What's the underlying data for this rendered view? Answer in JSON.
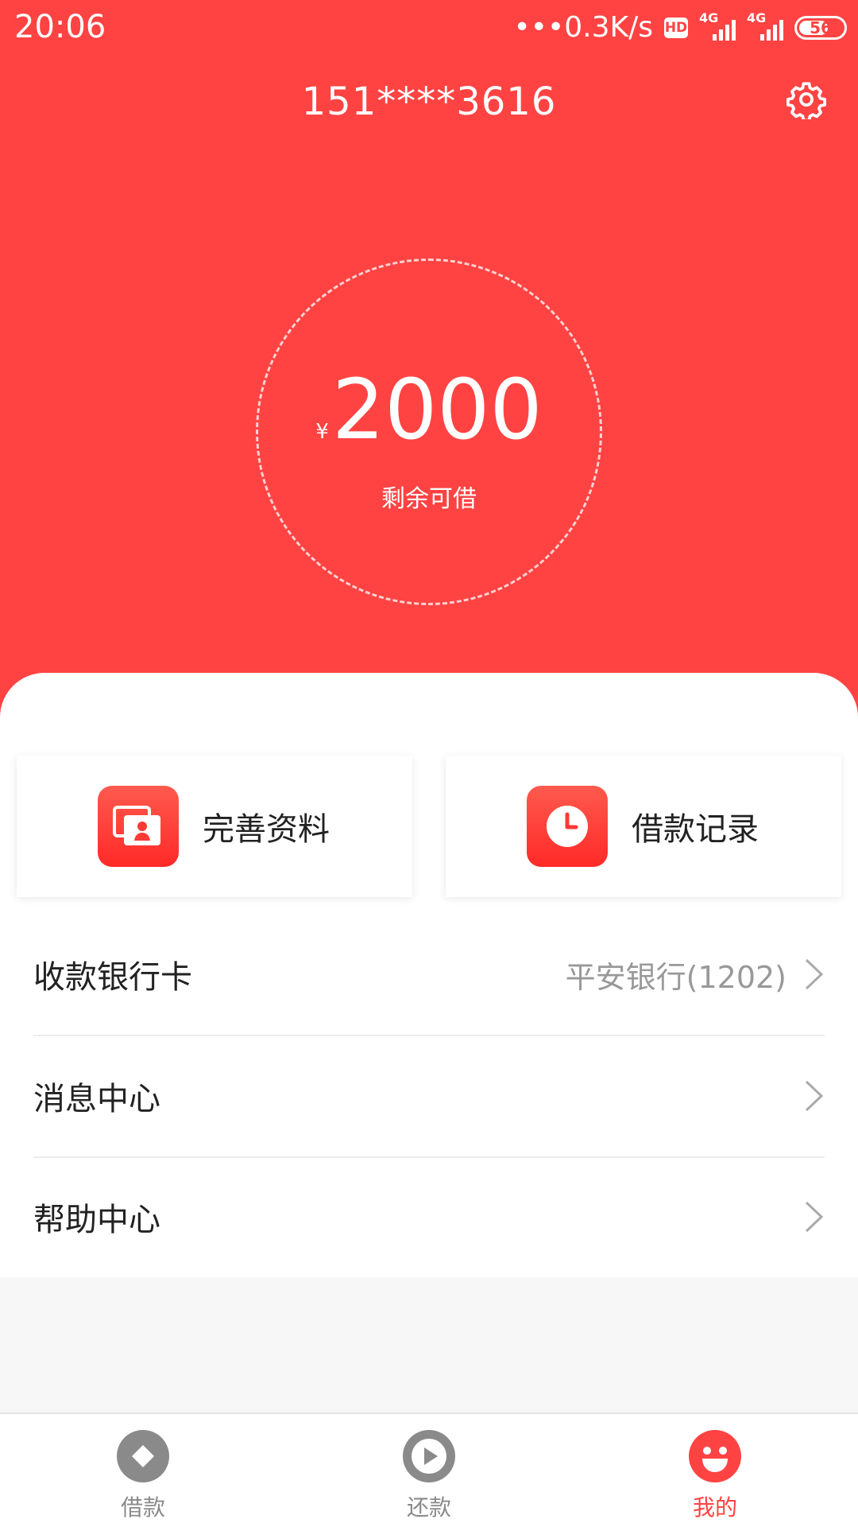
{
  "status_bar": {
    "time": "20:06",
    "net_speed": "•••0.3K/s",
    "hd": "HD",
    "signal1": "4G",
    "signal2": "4G",
    "battery": "56"
  },
  "header": {
    "phone": "151****3616",
    "currency": "¥",
    "amount": "2000",
    "amount_label": "剩余可借"
  },
  "cards": [
    {
      "label": "完善资料",
      "icon": "id-card-icon"
    },
    {
      "label": "借款记录",
      "icon": "clock-icon"
    }
  ],
  "menu": [
    {
      "label": "收款银行卡",
      "value": "平安银行(1202)"
    },
    {
      "label": "消息中心",
      "value": ""
    },
    {
      "label": "帮助中心",
      "value": ""
    }
  ],
  "tabs": [
    {
      "label": "借款",
      "icon": "diamond-icon",
      "active": false
    },
    {
      "label": "还款",
      "icon": "play-icon",
      "active": false
    },
    {
      "label": "我的",
      "icon": "smile-icon",
      "active": true
    }
  ],
  "colors": {
    "primary": "#ff4343",
    "inactive": "#8a8a8a"
  }
}
